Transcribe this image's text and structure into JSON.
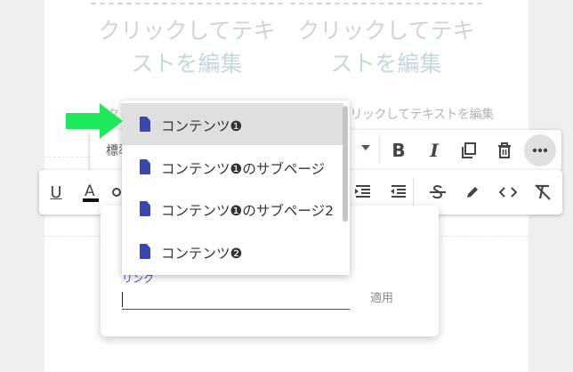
{
  "background_cards": {
    "left_text": "クリックしてテキストを編集",
    "right_text": "クリックしてテキストを編集",
    "faint_text": "クリックしてテキストを編集",
    "faint_partial": "クリ"
  },
  "toolbar_primary": {
    "style_select": "標準",
    "buttons": [
      "bold",
      "italic",
      "copy",
      "delete",
      "more"
    ]
  },
  "toolbar_secondary": {
    "buttons": [
      "underline",
      "font-color",
      "link",
      "indent",
      "outdent",
      "strikethrough",
      "highlight",
      "code",
      "clear-format"
    ]
  },
  "link_popup": {
    "label": "リンク",
    "input_value": "",
    "apply_label": "適用"
  },
  "dropdown": {
    "items": [
      {
        "label": "コンテンツ❶"
      },
      {
        "label": "コンテンツ❶のサブページ"
      },
      {
        "label": "コンテンツ❶のサブページ2"
      },
      {
        "label": "コンテンツ❷"
      }
    ],
    "selected_index": 0
  },
  "colors": {
    "accent": "#3f51b5",
    "doc_icon": "#3949ab",
    "arrow": "#1de95a",
    "selected_row": "#dfdfdf"
  }
}
